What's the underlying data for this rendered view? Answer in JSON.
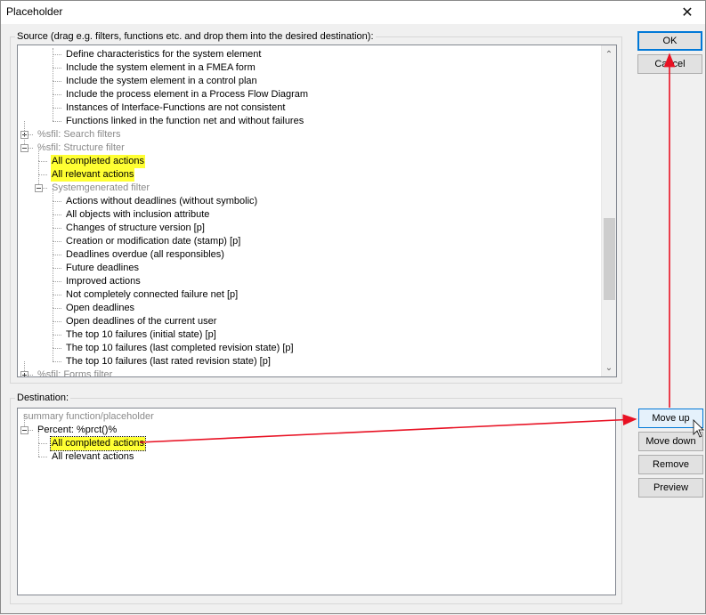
{
  "window": {
    "title": "Placeholder",
    "close_glyph": "✕"
  },
  "source": {
    "label": "Source (drag e.g. filters, functions etc. and drop them into the desired destination):",
    "rows": [
      {
        "text": "Define characteristics for the system element",
        "level": 3
      },
      {
        "text": "Include the system element in a FMEA form",
        "level": 3
      },
      {
        "text": "Include the system element in a control plan",
        "level": 3
      },
      {
        "text": "Include the process element in a Process Flow Diagram",
        "level": 3
      },
      {
        "text": "Instances of Interface-Functions are not consistent",
        "level": 3
      },
      {
        "text": "Functions linked in the function net and without failures",
        "level": 3
      },
      {
        "text": "%sfil: Search filters",
        "level": 1,
        "expander": "plus",
        "grey": true
      },
      {
        "text": "%sfil: Structure filter",
        "level": 1,
        "expander": "minus",
        "grey": true
      },
      {
        "text": "All completed actions",
        "level": 2,
        "highlight": true
      },
      {
        "text": "All relevant actions",
        "level": 2,
        "highlight": true
      },
      {
        "text": "Systemgenerated filter",
        "level": 2,
        "expander": "minus",
        "grey": true
      },
      {
        "text": "Actions without deadlines (without symbolic)",
        "level": 3
      },
      {
        "text": "All objects with inclusion attribute",
        "level": 3
      },
      {
        "text": "Changes of structure version [p]",
        "level": 3
      },
      {
        "text": "Creation or modification date (stamp) [p]",
        "level": 3
      },
      {
        "text": "Deadlines overdue (all responsibles)",
        "level": 3
      },
      {
        "text": "Future deadlines",
        "level": 3
      },
      {
        "text": "Improved actions",
        "level": 3
      },
      {
        "text": "Not completely connected failure net [p]",
        "level": 3
      },
      {
        "text": "Open deadlines",
        "level": 3
      },
      {
        "text": "Open deadlines of the current user",
        "level": 3
      },
      {
        "text": "The top 10 failures (initial state) [p]",
        "level": 3
      },
      {
        "text": "The top 10 failures (last completed revision state) [p]",
        "level": 3
      },
      {
        "text": "The top 10 failures (last rated revision state) [p]",
        "level": 3
      },
      {
        "text": "%sfil: Forms filter",
        "level": 1,
        "expander": "plus",
        "grey": true
      }
    ]
  },
  "destination": {
    "label": "Destination:",
    "rows": [
      {
        "text": "summary function/placeholder",
        "level": 0,
        "grey": true
      },
      {
        "text": "Percent: %prct()%",
        "level": 1,
        "expander": "minus"
      },
      {
        "text": "All completed actions",
        "level": 2,
        "highlight": true,
        "focused": true
      },
      {
        "text": "All relevant actions",
        "level": 2
      }
    ]
  },
  "buttons": {
    "ok": "OK",
    "cancel": "Cancel",
    "move_up": "Move up",
    "move_down": "Move down",
    "remove": "Remove",
    "preview": "Preview"
  },
  "scroll": {
    "up_glyph": "⌃",
    "down_glyph": "⌄",
    "position": 0.72
  },
  "annotation_color": "#e81123"
}
